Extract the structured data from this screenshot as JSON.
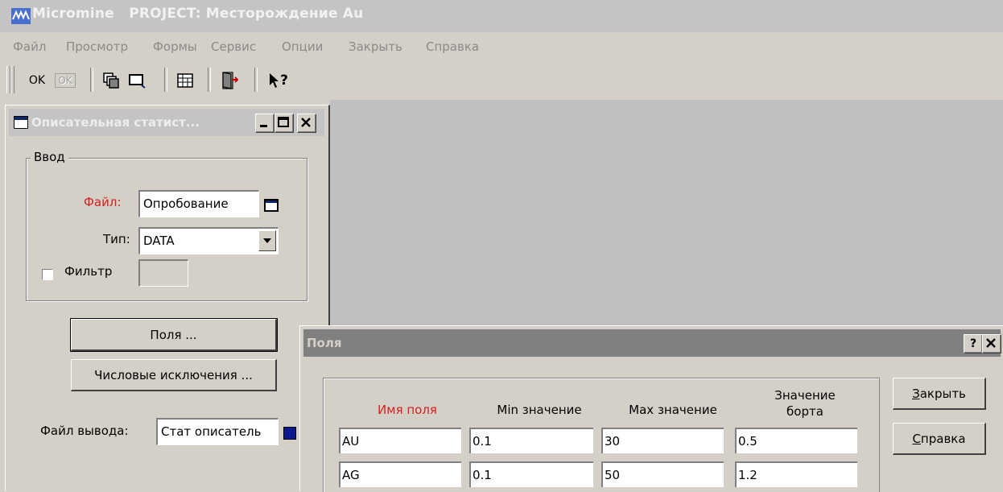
{
  "app": {
    "title": "Micromine   PROJECT: Месторождение Au",
    "menu": [
      "Файл",
      "Просмотр",
      "Формы",
      "Сервис",
      "Опции",
      "Закрыть",
      "Справка"
    ]
  },
  "toolbar": {
    "ok_label": "OK",
    "ok_disabled_label": "OK",
    "help_pointer_label": "?"
  },
  "stat_window": {
    "title": "Описательная статист...",
    "input_group_label": "Ввод",
    "file_label": "Файл:",
    "file_value": "Опробование",
    "type_label": "Тип:",
    "type_value": "DATA",
    "filter_label": "Фильтр",
    "filter_checked": false,
    "fields_button": "Поля ...",
    "numeric_exclusions_button": "Числовые исключения ...",
    "output_file_label": "Файл вывода:",
    "output_file_value": "Стат описатель"
  },
  "fields_dialog": {
    "title": "Поля",
    "help_caption": "?",
    "close_button": "акрыть",
    "close_button_mnemonic": "З",
    "help_button": "правка",
    "help_button_mnemonic": "С",
    "columns": [
      "Имя поля",
      "Min значение",
      "Max значение",
      "Значение",
      "борта"
    ],
    "rows": [
      [
        "AU",
        "0.1",
        "30",
        "0.5"
      ],
      [
        "AG",
        "0.1",
        "50",
        "1.2"
      ]
    ]
  },
  "colors": {
    "required_label": "#d32020",
    "titlebar_inactive": "#c4c4c4",
    "dialog_titlebar": "#808080",
    "output_color_swatch": "#0a1a8c"
  }
}
